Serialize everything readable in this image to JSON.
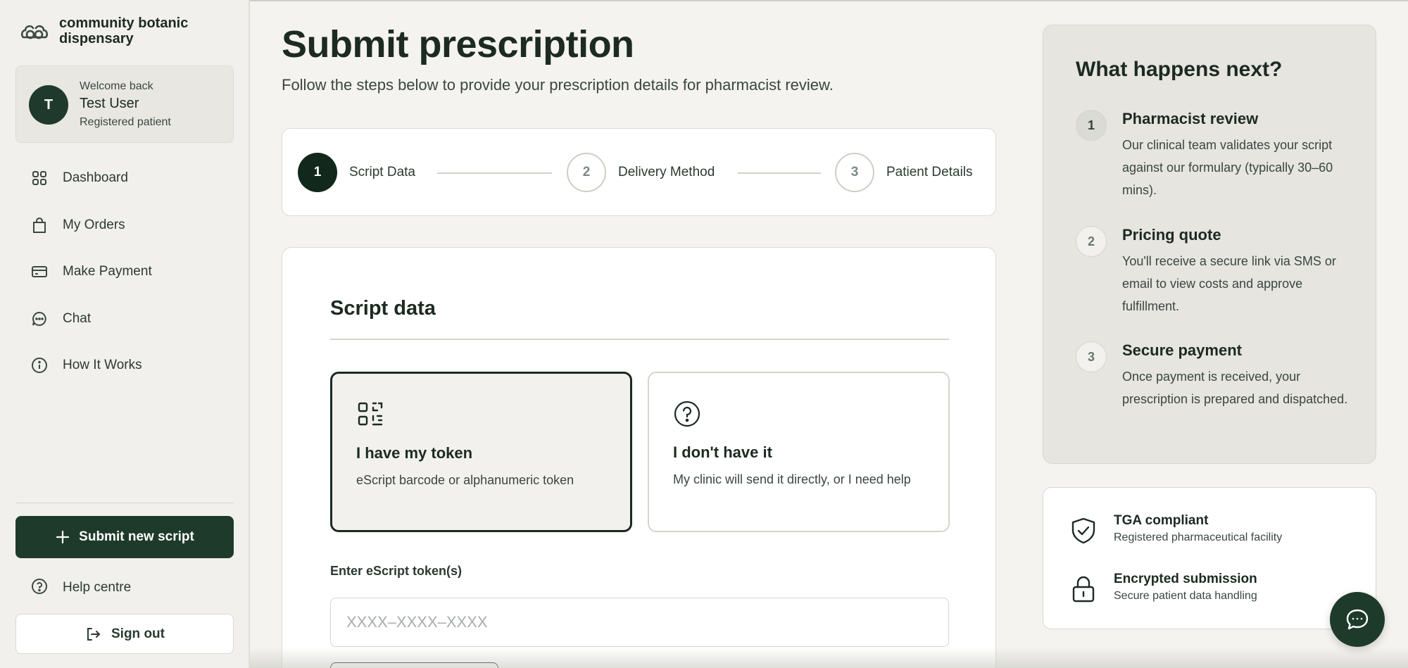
{
  "brand": {
    "name": "community botanic dispensary"
  },
  "user": {
    "welcome": "Welcome back",
    "name": "Test User",
    "role": "Registered patient",
    "initial": "T"
  },
  "nav": {
    "items": [
      {
        "label": "Dashboard",
        "icon": "grid-icon"
      },
      {
        "label": "My Orders",
        "icon": "bag-icon"
      },
      {
        "label": "Make Payment",
        "icon": "card-icon"
      },
      {
        "label": "Chat",
        "icon": "chat-bubble-icon"
      },
      {
        "label": "How It Works",
        "icon": "info-icon"
      }
    ]
  },
  "sidebar_actions": {
    "submit_label": "Submit new script",
    "help_label": "Help centre",
    "signout_label": "Sign out"
  },
  "page": {
    "title": "Submit prescription",
    "subtitle": "Follow the steps below to provide your prescription details for pharmacist review."
  },
  "steps": [
    {
      "num": "1",
      "label": "Script Data",
      "state": "active"
    },
    {
      "num": "2",
      "label": "Delivery Method",
      "state": "idle"
    },
    {
      "num": "3",
      "label": "Patient Details",
      "state": "idle"
    }
  ],
  "form": {
    "title": "Script data",
    "options": [
      {
        "title": "I have my token",
        "desc": "eScript barcode or alphanumeric token",
        "selected": true
      },
      {
        "title": "I don't have it",
        "desc": "My clinic will send it directly, or I need help",
        "selected": false
      }
    ],
    "token_label": "Enter eScript token(s)",
    "token_placeholder": "XXXX–XXXX–XXXX",
    "token_value": ""
  },
  "next": {
    "title": "What happens next?",
    "items": [
      {
        "num": "1",
        "head": "Pharmacist review",
        "body": "Our clinical team validates your script against our formulary (typically 30–60 mins)."
      },
      {
        "num": "2",
        "head": "Pricing quote",
        "body": "You'll receive a secure link via SMS or email to view costs and approve fulfillment."
      },
      {
        "num": "3",
        "head": "Secure payment",
        "body": "Once payment is received, your prescription is prepared and dispatched."
      }
    ]
  },
  "trust": [
    {
      "head": "TGA compliant",
      "sub": "Registered pharmaceutical facility",
      "icon": "shield-check-icon"
    },
    {
      "head": "Encrypted submission",
      "sub": "Secure patient data handling",
      "icon": "lock-icon"
    }
  ],
  "colors": {
    "primary": "#1e3a2a",
    "background": "#f4f3ef",
    "panel": "#e6e5e0",
    "border": "#d6d4ce"
  }
}
